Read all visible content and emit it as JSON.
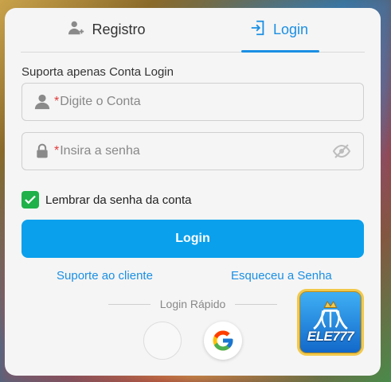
{
  "tabs": [
    {
      "label": "Registro",
      "icon": "add-user-icon",
      "active": false
    },
    {
      "label": "Login",
      "icon": "login-icon",
      "active": true
    }
  ],
  "hint": "Suporta apenas Conta Login",
  "account_field": {
    "required_mark": "*",
    "placeholder": "Digite o Conta",
    "value": "",
    "icon": "user-icon"
  },
  "password_field": {
    "required_mark": "*",
    "placeholder": "Insira a senha",
    "value": "",
    "icon": "lock-icon",
    "toggle_icon": "eye-off-icon"
  },
  "remember": {
    "label": "Lembrar da senha da conta",
    "checked": true
  },
  "login_button": "Login",
  "links": {
    "support": "Suporte ao cliente",
    "forgot": "Esqueceu a Senha"
  },
  "quick_login": {
    "label": "Login Rápido",
    "providers": [
      "blank",
      "google"
    ]
  },
  "brand": {
    "name": "ELE777"
  },
  "colors": {
    "accent": "#1a8fe3",
    "button": "#0aa0ec",
    "check": "#20b14a",
    "required": "#e23b3b"
  }
}
